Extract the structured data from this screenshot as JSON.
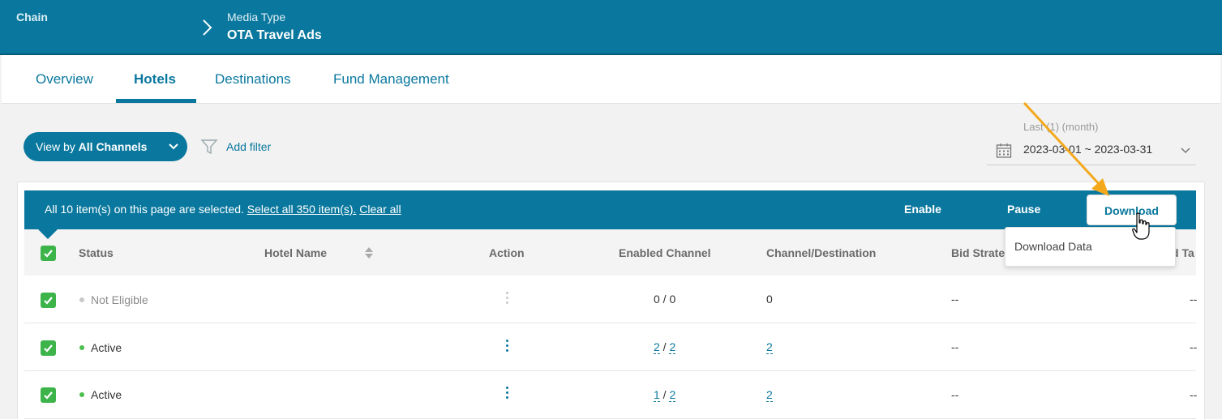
{
  "header": {
    "chain_label": "Chain",
    "media_type_label": "Media Type",
    "media_type_value": "OTA Travel Ads"
  },
  "tabs": [
    {
      "label": "Overview",
      "active": false
    },
    {
      "label": "Hotels",
      "active": true
    },
    {
      "label": "Destinations",
      "active": false
    },
    {
      "label": "Fund Management",
      "active": false
    }
  ],
  "toolbar": {
    "view_prefix": "View by ",
    "view_bold": "All Channels",
    "add_filter": "Add filter"
  },
  "date_range": {
    "label": "Last (1) (month)",
    "value": "2023-03-01 ~ 2023-03-31"
  },
  "selection_bar": {
    "message": "All 10 item(s) on this page are selected.",
    "select_all": "Select all 350 item(s).",
    "clear_all": "Clear all",
    "enable": "Enable",
    "pause": "Pause",
    "download": "Download"
  },
  "download_menu": {
    "items": [
      "Download Data"
    ]
  },
  "table": {
    "columns": [
      "Status",
      "Hotel Name",
      "Action",
      "Enabled Channel",
      "Channel/Destination",
      "Bid Strate",
      "d Ta"
    ],
    "rows": [
      {
        "status": "Not Eligible",
        "hotel_name": "",
        "enabled_a": "0",
        "enabled_sep": " / ",
        "enabled_b": "0",
        "channel_destination": "0",
        "bid_strategy": "--",
        "last": "--"
      },
      {
        "status": "Active",
        "hotel_name": "",
        "enabled_a": "2",
        "enabled_sep": " / ",
        "enabled_b": "2",
        "channel_destination": "2",
        "bid_strategy": "--",
        "last": "--"
      },
      {
        "status": "Active",
        "hotel_name": "",
        "enabled_a": "1",
        "enabled_sep": " / ",
        "enabled_b": "2",
        "channel_destination": "2",
        "bid_strategy": "--",
        "last": "--"
      }
    ]
  },
  "colors": {
    "brand": "#0a789e",
    "check": "#3cb44a",
    "active_dot": "#4cbf4c",
    "inactive_dot": "#c8c8c8",
    "annotation": "#f4a81c"
  }
}
